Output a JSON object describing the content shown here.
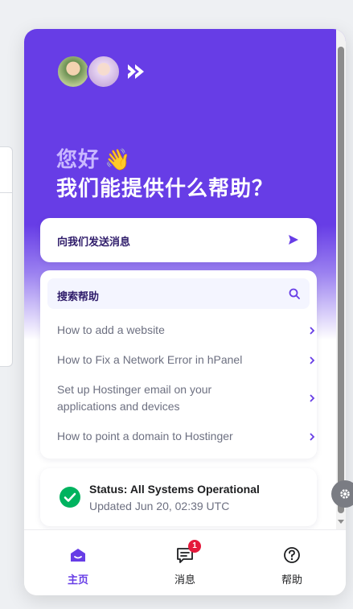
{
  "header": {
    "greeting_line1": "您好",
    "greeting_emoji": "👋",
    "greeting_line2": "我们能提供什么帮助？"
  },
  "send_message": {
    "label": "向我们发送消息"
  },
  "help": {
    "search_label": "搜索帮助",
    "articles": [
      "How to add a website",
      "How to Fix a Network Error in hPanel",
      "Set up Hostinger email on your applications and devices",
      "How to point a domain to Hostinger"
    ]
  },
  "status": {
    "title": "Status: All Systems Operational",
    "updated": "Updated Jun 20, 02:39 UTC"
  },
  "tabs": [
    {
      "label": "主页",
      "icon": "home-icon",
      "active": true
    },
    {
      "label": "消息",
      "icon": "chat-icon",
      "badge": "1"
    },
    {
      "label": "帮助",
      "icon": "question-icon"
    }
  ],
  "colors": {
    "brand": "#673de6",
    "success": "#00b35f",
    "badge": "#e5193c"
  }
}
